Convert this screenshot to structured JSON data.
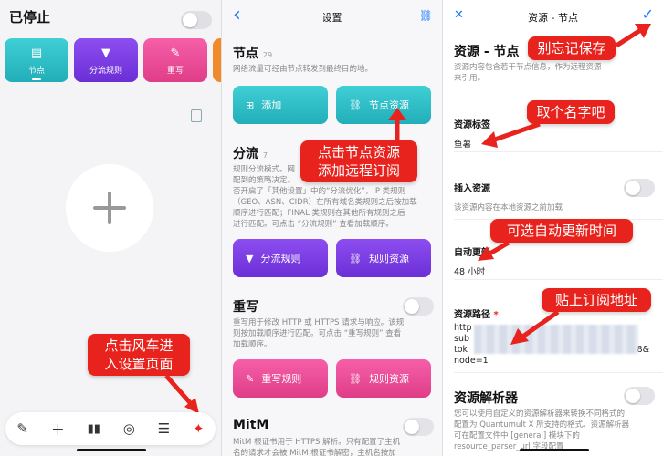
{
  "panel1": {
    "status": "已停止",
    "tiles": [
      "节点",
      "分流规则",
      "重写"
    ],
    "callout": [
      "点击风车进",
      "入设置页面"
    ],
    "tabbar": [
      "edit-icon",
      "plus-icon",
      "bars-icon",
      "globe-icon",
      "list-icon",
      "windmill-icon"
    ]
  },
  "panel2": {
    "title": "设置",
    "back": "‹",
    "link_icon": "🔗",
    "nodes": {
      "title": "节点",
      "count": "29",
      "desc": "网络流量可经由节点转发到最终目的地。",
      "add": "添加",
      "resource": "节点资源"
    },
    "callout": [
      "点击节点资源",
      "添加远程订阅"
    ],
    "filter": {
      "title": "分流",
      "count": "7",
      "desc": [
        "规则分流模式。网",
        "配到的策略决定。",
        "否开启了「其他设置」中的“分流优化”，IP 类规则",
        "（GEO、ASN、CIDR）在所有域名类规则之后按加载",
        "顺序进行匹配；FINAL 类规则在其他所有规则之后",
        "进行匹配。可点击 “分流规则” 查看加载顺序。"
      ],
      "rules": "分流规则",
      "resource": "规则资源"
    },
    "rewrite": {
      "title": "重写",
      "desc": [
        "重写用于修改 HTTP 或 HTTPS 请求与响应。该规",
        "则按加载顺序进行匹配。可点击 “重写规则” 查看",
        "加载顺序。"
      ],
      "rules": "重写规则",
      "resource": "规则资源"
    },
    "mitm": {
      "title": "MitM",
      "desc": [
        "MitM 根证书用于 HTTPS 解析。只有配置了主机",
        "名的请求才会被 MitM 根证书解密，主机名按加"
      ]
    }
  },
  "panel3": {
    "title": "资源 - 节点",
    "close": "✕",
    "check": "✓",
    "heading": "资源 - 节点",
    "heading_desc": [
      "资源内容包含若干节点信息，作为远程资源",
      "来引用。"
    ],
    "callout_save": "别忘记保存",
    "callout_name": "取个名字吧",
    "callout_update": "可选自动更新时间",
    "callout_url": "贴上订阅地址",
    "tag_label": "资源标签",
    "tag_value": "鱼薯",
    "insert_label": "插入资源",
    "insert_desc": "该资源内容在本地资源之前加载",
    "update_label": "自动更新",
    "update_value": "48 小时",
    "path_label": "资源路径",
    "required": "*",
    "path_lines": [
      "http",
      "sub",
      "tok",
      "node=1"
    ],
    "path_tail": "8&",
    "parser_label": "资源解析器",
    "parser_desc": [
      "您可以使用自定义的资源解析器来转换不同格式的",
      "配置为 Quantumult X 所支持的格式。资源解析器",
      "可在配置文件中 [general] 模块下的",
      "resource_parser_url 字段配置"
    ]
  },
  "colors": {
    "teal": "#2bbac4",
    "purple": "#7b3be3",
    "pink": "#ee4f98",
    "callout": "#e8221c",
    "accent": "#1677ff"
  }
}
